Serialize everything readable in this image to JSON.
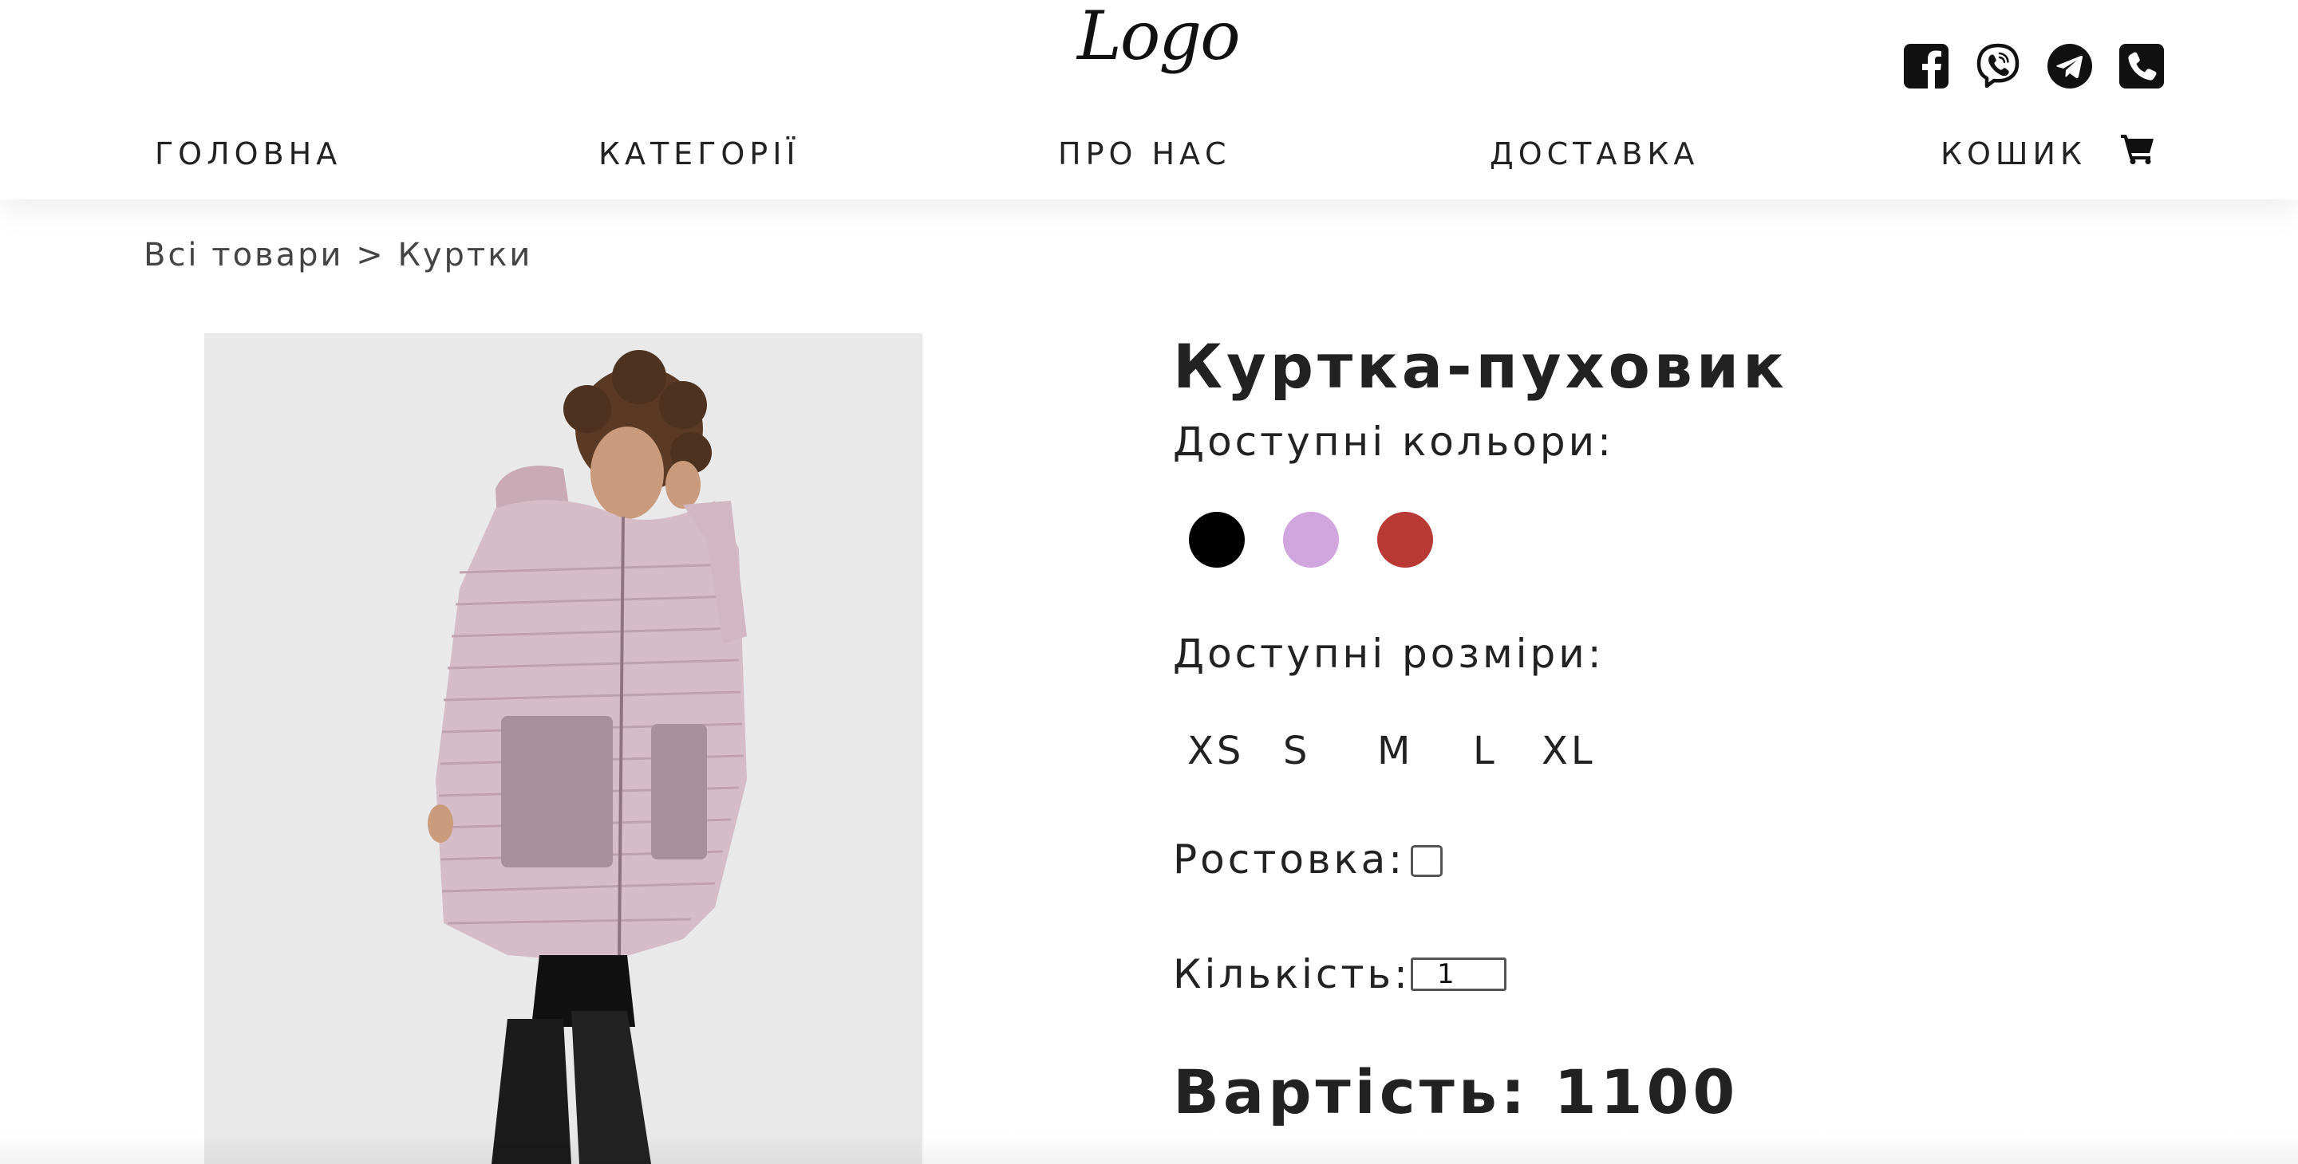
{
  "header": {
    "logo_text": "Logo",
    "socials": [
      {
        "name": "facebook-icon"
      },
      {
        "name": "viber-icon"
      },
      {
        "name": "telegram-icon"
      },
      {
        "name": "phone-icon"
      }
    ]
  },
  "nav": {
    "home": "ГОЛОВНА",
    "categories": "КАТЕГОРІЇ",
    "about": "ПРО НАС",
    "delivery": "ДОСТАВКА",
    "cart": "КОШИК"
  },
  "breadcrumb": {
    "all": "Всі товари",
    "separator": ">",
    "current": "Куртки"
  },
  "product": {
    "title": "Куртка-пуховик",
    "colors_label": "Доступні кольори:",
    "colors": [
      "#000000",
      "#d1a6de",
      "#b93a34"
    ],
    "sizes_label": "Доступні розміри:",
    "sizes": [
      "XS",
      "S",
      "M",
      "L",
      "XL"
    ],
    "rostovka_label": "Ростовка:",
    "quantity_label": "Кількість:",
    "quantity_value": "1",
    "price": "Вартість: 1100"
  }
}
